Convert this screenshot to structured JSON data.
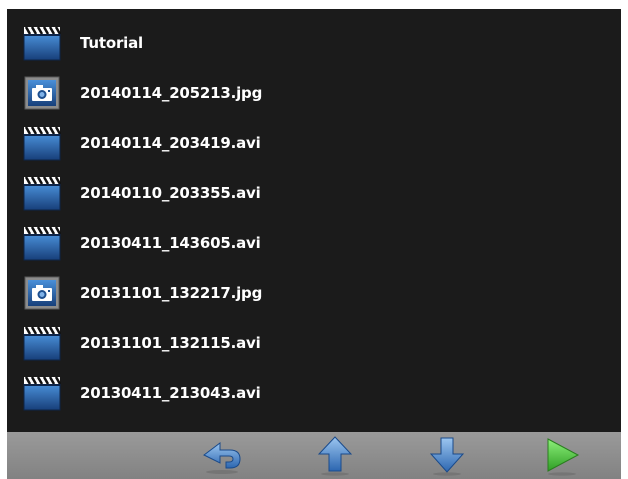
{
  "files": [
    {
      "name": "Tutorial",
      "icon": "video-clapper-icon"
    },
    {
      "name": "20140114_205213.jpg",
      "icon": "camera-icon"
    },
    {
      "name": "20140114_203419.avi",
      "icon": "video-clapper-icon"
    },
    {
      "name": "20140110_203355.avi",
      "icon": "video-clapper-icon"
    },
    {
      "name": "20130411_143605.avi",
      "icon": "video-clapper-icon"
    },
    {
      "name": "20131101_132217.jpg",
      "icon": "camera-icon"
    },
    {
      "name": "20131101_132115.avi",
      "icon": "video-clapper-icon"
    },
    {
      "name": "20130411_213043.avi",
      "icon": "video-clapper-icon"
    }
  ],
  "toolbar": {
    "buttons": [
      {
        "icon": "back-arrow-icon"
      },
      {
        "icon": "up-arrow-icon"
      },
      {
        "icon": "down-arrow-icon"
      },
      {
        "icon": "play-icon"
      }
    ]
  },
  "colors": {
    "background": "#1b1b1b",
    "toolbar": "#8e8e8e",
    "icon_blue": "#2a6fb5",
    "play_green": "#4cc23a"
  }
}
